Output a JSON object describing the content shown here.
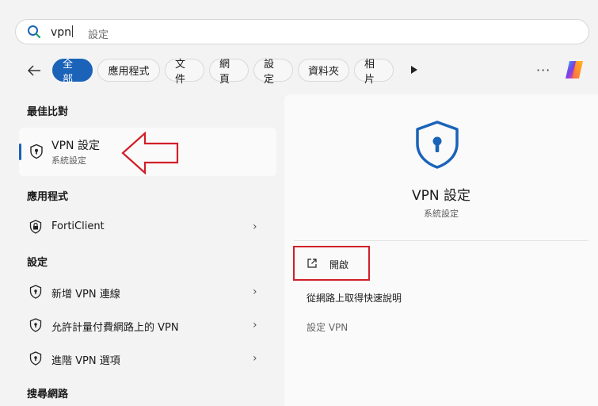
{
  "search": {
    "typed": "vpn",
    "placeholder_hint": "設定"
  },
  "tabs": [
    "全部",
    "應用程式",
    "文件",
    "網頁",
    "設定",
    "資料夾",
    "相片"
  ],
  "more_label": "···",
  "sections": {
    "best_match": "最佳比對",
    "apps": "應用程式",
    "settings": "設定",
    "web": "搜尋網路"
  },
  "best_match": {
    "title": "VPN 設定",
    "subtitle": "系統設定"
  },
  "apps": [
    {
      "label": "FortiClient"
    }
  ],
  "settings": [
    {
      "label": "新增 VPN 連線"
    },
    {
      "label": "允許計量付費網路上的 VPN"
    },
    {
      "label": "進階 VPN 選項"
    }
  ],
  "panel": {
    "title": "VPN 設定",
    "subtitle": "系統設定",
    "open_label": "開啟",
    "help_label": "從網路上取得快速說明",
    "vpn_settings_label": "設定 VPN"
  },
  "colors": {
    "accent": "#1a63b8",
    "highlight_red": "#d11f2a"
  }
}
